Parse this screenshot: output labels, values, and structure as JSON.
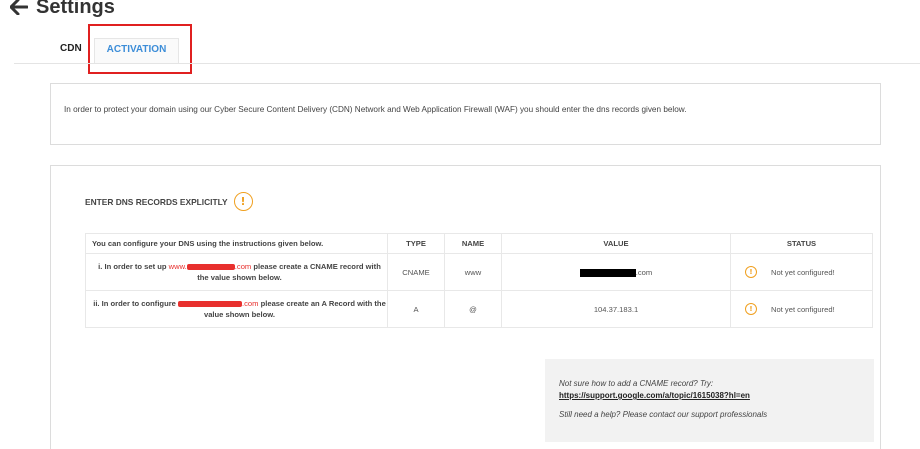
{
  "header": {
    "back_icon": "arrow-left-icon",
    "title": "Settings"
  },
  "tabs": [
    {
      "label": "CDN"
    },
    {
      "label": "ACTIVATION",
      "active": true
    }
  ],
  "info": {
    "text": "In order to protect your domain using our Cyber Secure Content Delivery (CDN) Network and Web Application Firewall (WAF) you should enter the dns records given below."
  },
  "dns": {
    "heading": "ENTER DNS RECORDS EXPLICITLY",
    "heading_icon": "warning-icon",
    "columns": {
      "instructions": "You can configure your DNS using the instructions given below.",
      "type": "TYPE",
      "name": "NAME",
      "value": "VALUE",
      "status": "STATUS"
    },
    "rows": [
      {
        "inst_prefix": "i. In order to set up ",
        "domain_prefix": "www.",
        "domain_suffix": ".com",
        "inst_suffix": " please create a CNAME record with the value shown below.",
        "type": "CNAME",
        "name": "www",
        "value_suffix": ".com",
        "status": "Not yet configured!"
      },
      {
        "inst_prefix": "ii. In order to configure ",
        "domain_suffix": ".com",
        "inst_suffix": " please create an A Record with the value shown below.",
        "type": "A",
        "name": "@",
        "value": "104.37.183.1",
        "status": "Not yet configured!"
      }
    ]
  },
  "help": {
    "question": "Not sure how to add a CNAME record? Try:",
    "link": "https://support.google.com/a/topic/1615038?hl=en",
    "more": "Still need a help? Please contact our support professionals"
  },
  "colors": {
    "accent": "#3c8dd8",
    "warning": "#f0a020",
    "highlight": "#e02020",
    "redaction": "#e8302e"
  }
}
